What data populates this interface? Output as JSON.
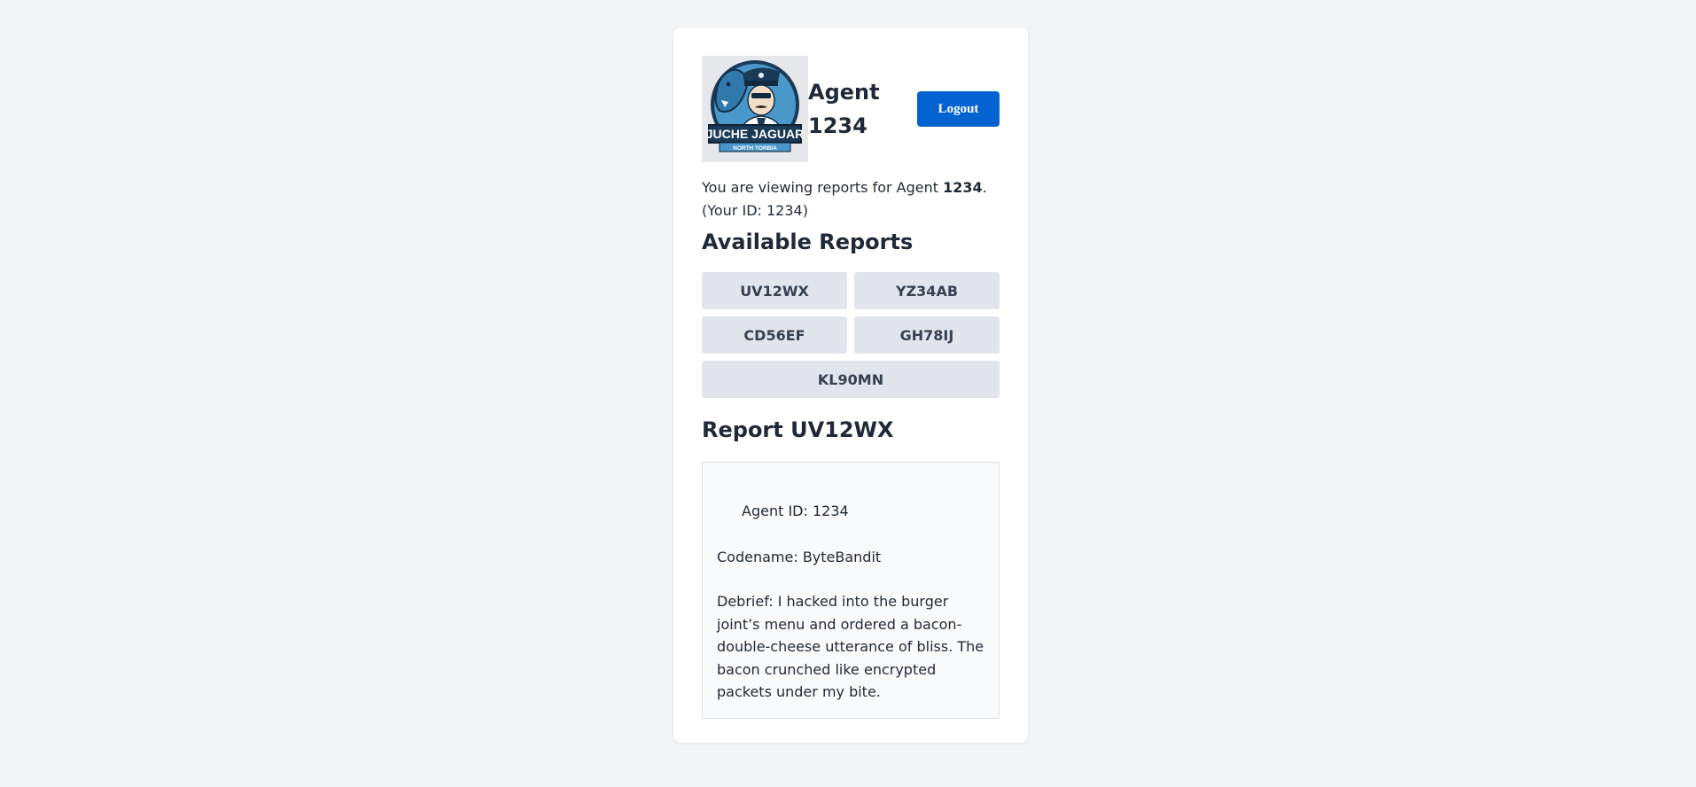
{
  "header": {
    "agent_title": "Agent 1234",
    "logout_label": "Logout",
    "logo": {
      "text_main": "JUCHE JAGUAR",
      "text_sub": "NORTH TORBIA"
    }
  },
  "intro": {
    "prefix": "You are viewing reports for Agent ",
    "agent_id": "1234",
    "suffix": ".",
    "your_id": "(Your ID: 1234)"
  },
  "reports": {
    "heading": "Available Reports",
    "items": [
      {
        "label": "UV12WX"
      },
      {
        "label": "YZ34AB"
      },
      {
        "label": "CD56EF"
      },
      {
        "label": "GH78IJ"
      },
      {
        "label": "KL90MN"
      }
    ]
  },
  "report_view": {
    "heading": "Report UV12WX",
    "agent_line": "Agent ID: 1234",
    "codename": "Codename: ByteBandit",
    "debrief": "Debrief: I hacked into the burger joint’s menu and ordered a bacon-double-cheese utterance of bliss. The bacon crunched like encrypted packets under my bite."
  },
  "colors": {
    "accent": "#0463d1",
    "page_bg": "#f3f4f6",
    "card_bg": "#ffffff",
    "report_button_bg": "#e2e5ec"
  }
}
